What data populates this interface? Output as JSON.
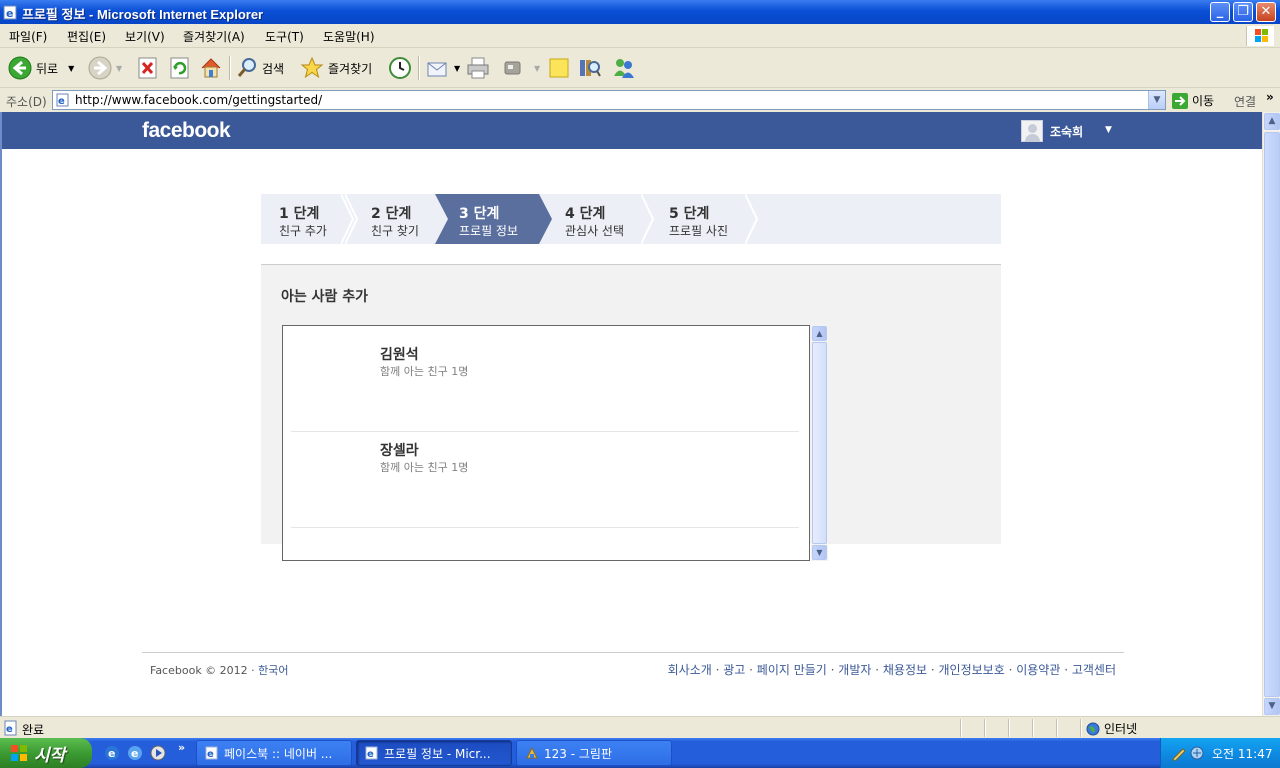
{
  "window": {
    "title": "프로필 정보 - Microsoft Internet Explorer",
    "minimize": "_",
    "maximize": "❐",
    "close": "✕"
  },
  "menu": [
    "파일(F)",
    "편집(E)",
    "보기(V)",
    "즐겨찾기(A)",
    "도구(T)",
    "도움말(H)"
  ],
  "toolbar": {
    "back": "뒤로",
    "search": "검색",
    "favorites": "즐겨찾기"
  },
  "address": {
    "label": "주소(D)",
    "url": "http://www.facebook.com/gettingstarted/",
    "go": "이동",
    "links": "연결",
    "more": "»"
  },
  "facebook": {
    "logo": "facebook",
    "user_name": "조숙희",
    "steps": [
      {
        "num": "1 단계",
        "label": "친구 추가"
      },
      {
        "num": "2 단계",
        "label": "친구 찾기"
      },
      {
        "num": "3 단계",
        "label": "프로필 정보"
      },
      {
        "num": "4 단계",
        "label": "관심사 선택"
      },
      {
        "num": "5 단계",
        "label": "프로필 사진"
      }
    ],
    "active_step": 3,
    "panel_title": "아는 사람 추가",
    "people": [
      {
        "name": "김원석",
        "mutual": "함께 아는 친구 1명"
      },
      {
        "name": "장셀라",
        "mutual": "함께 아는 친구 1명"
      }
    ],
    "footer": {
      "copyright": "Facebook © 2012 · ",
      "language": "한국어",
      "links": [
        "회사소개",
        "광고",
        "페이지 만들기",
        "개발자",
        "채용정보",
        "개인정보보호",
        "이용약관",
        "고객센터"
      ]
    }
  },
  "status": {
    "text": "완료",
    "zone": "인터넷"
  },
  "taskbar": {
    "start": "시작",
    "tasks": [
      "페이스북 :: 네이버 ...",
      "프로필 정보 - Micr...",
      "123 - 그림판"
    ],
    "clock": "오전 11:47"
  },
  "colors": {
    "fb_blue": "#3b5998",
    "step_active": "#5b6f9e"
  }
}
